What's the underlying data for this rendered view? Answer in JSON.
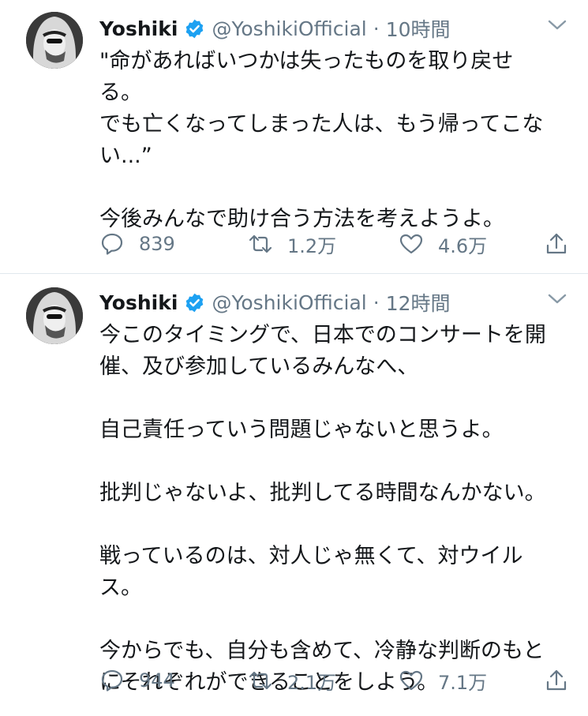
{
  "tweets": [
    {
      "author": {
        "name": "Yoshiki",
        "handle": "@YoshikiOfficial"
      },
      "separator": "·",
      "time": "10時間",
      "paragraphs": [
        "\"命があればいつかは失ったものを取り戻せ\nる。\nでも亡くなってしまった人は、もう帰ってこな\nい...”",
        "今後みんなで助け合う方法を考えようよ。"
      ],
      "stats": {
        "replies": "839",
        "retweets": "1.2万",
        "likes": "4.6万"
      }
    },
    {
      "author": {
        "name": "Yoshiki",
        "handle": "@YoshikiOfficial"
      },
      "separator": "·",
      "time": "12時間",
      "paragraphs": [
        "今このタイミングで、日本でのコンサートを開\n催、及び参加しているみんなへ、",
        "自己責任っていう問題じゃないと思うよ。",
        "批判じゃないよ、批判してる時間なんかない。",
        "戦っているのは、対人じゃ無くて、対ウイル\nス。",
        "今からでも、自分も含めて、冷静な判断のもと\nにそれぞれができることをしよう。"
      ],
      "stats": {
        "replies": "944",
        "retweets": "2.1万",
        "likes": "7.1万"
      }
    }
  ],
  "icons": {
    "verified": "verified-badge-icon",
    "menu": "chevron-down-icon",
    "reply": "reply-icon",
    "retweet": "retweet-icon",
    "like": "heart-icon",
    "share": "share-icon"
  },
  "colors": {
    "text": "#14171a",
    "secondary": "#657786",
    "verified": "#1da1f2",
    "divider": "#e1e8ed"
  }
}
